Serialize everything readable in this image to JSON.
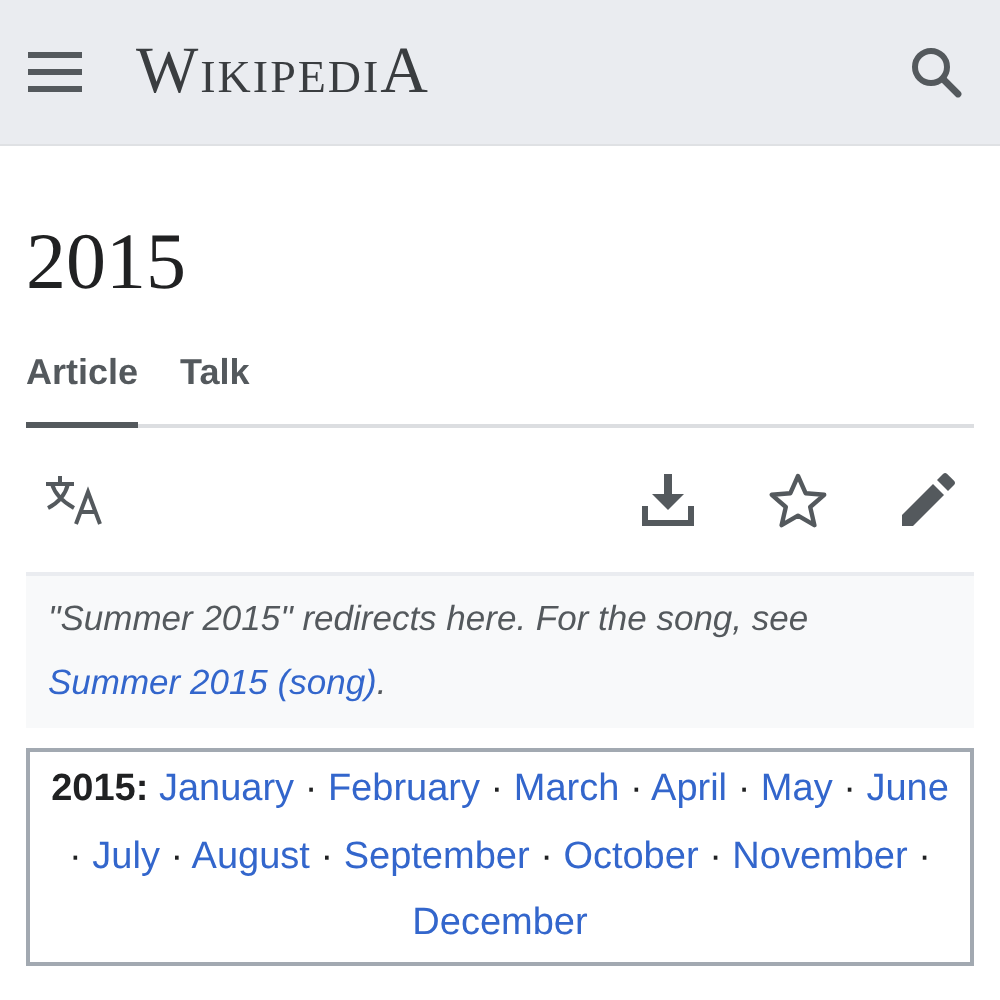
{
  "header": {
    "logo": "WikipediA"
  },
  "page": {
    "title": "2015"
  },
  "tabs": [
    {
      "label": "Article",
      "selected": true
    },
    {
      "label": "Talk",
      "selected": false
    }
  ],
  "hatnote": {
    "text": "\"Summer 2015\" redirects here. For the song, see ",
    "link": "Summer 2015 (song)",
    "after": "."
  },
  "navbox": {
    "label": "2015:",
    "separator": "·",
    "links": [
      "January",
      "February",
      "March",
      "April",
      "May",
      "June",
      "July",
      "August",
      "September",
      "October",
      "November",
      "December"
    ]
  }
}
